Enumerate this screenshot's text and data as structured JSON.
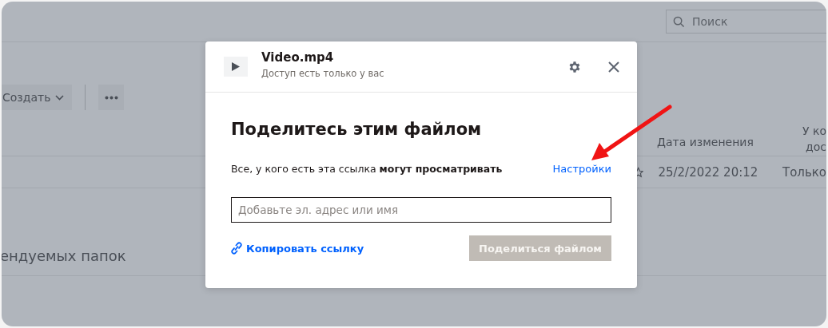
{
  "search": {
    "placeholder": "Поиск"
  },
  "toolbar": {
    "create_label": "Создать"
  },
  "table": {
    "columns": [
      {
        "lines": [
          "Дата изменения"
        ]
      },
      {
        "lines": [
          "У ко",
          "дос"
        ]
      }
    ],
    "rows": [
      {
        "starred": false,
        "modified": "25/2/2022 20:12",
        "column_2": "Только"
      }
    ]
  },
  "section_title": "ендуемых папок",
  "dialog": {
    "file_name": "Video.mp4",
    "access_note": "Доступ есть только у вас",
    "heading": "Поделитесь этим файлом",
    "link_permission": "Все, у кого есть эта ссылка **могут просматривать**",
    "settings_link": "Настройки",
    "invite": {
      "placeholder": "Добавьте эл. адрес или имя"
    },
    "copy_link": "Копировать ссылку",
    "share_button": {
      "label": "Поделиться файлом",
      "disabled": true
    }
  }
}
